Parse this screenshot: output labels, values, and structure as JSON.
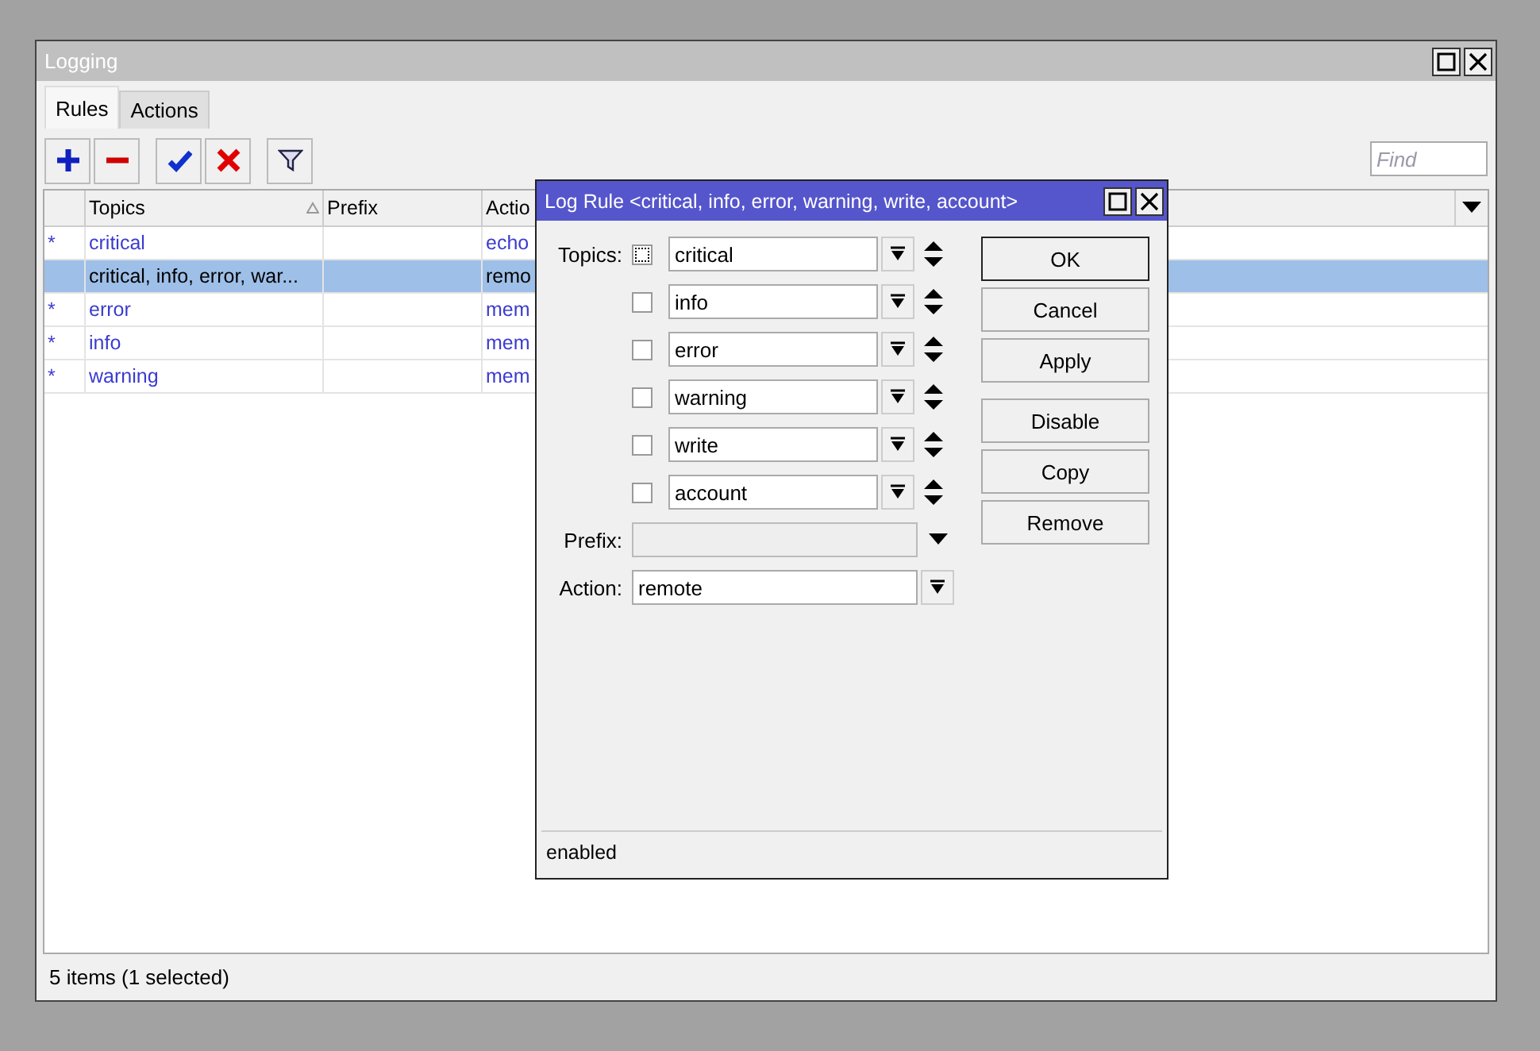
{
  "window": {
    "title": "Logging"
  },
  "tabs": [
    {
      "label": "Rules",
      "selected": true
    },
    {
      "label": "Actions",
      "selected": false
    }
  ],
  "toolbar": {
    "buttons": [
      {
        "kind": "add"
      },
      {
        "kind": "remove"
      },
      {
        "kind": "enable"
      },
      {
        "kind": "disable"
      },
      {
        "kind": "filter"
      }
    ],
    "find": {
      "placeholder": "Find"
    }
  },
  "table": {
    "columns": [
      {
        "label": "Topics",
        "sorted": true
      },
      {
        "label": "Prefix",
        "sorted": false
      },
      {
        "label": "Actio"
      }
    ],
    "rows": [
      {
        "flag": "*",
        "dynamic": true,
        "selected": false,
        "cells": [
          "critical",
          "",
          "echo"
        ]
      },
      {
        "dynamic": false,
        "selected": true,
        "cells": [
          "critical, info, error, war...",
          "",
          "remo"
        ]
      },
      {
        "flag": "*",
        "dynamic": true,
        "selected": false,
        "cells": [
          "error",
          "",
          "mem"
        ]
      },
      {
        "flag": "*",
        "dynamic": true,
        "selected": false,
        "cells": [
          "info",
          "",
          "mem"
        ]
      },
      {
        "flag": "*",
        "dynamic": true,
        "selected": false,
        "cells": [
          "warning",
          "",
          "mem"
        ]
      }
    ]
  },
  "status_bar": "5 items (1 selected)",
  "dialog": {
    "title": "Log Rule <critical, info, error, warning, write, account>",
    "topics_label": "Topics:",
    "topics": [
      {
        "value": "critical",
        "checked": false,
        "focused": true
      },
      {
        "value": "info",
        "checked": false,
        "focused": false
      },
      {
        "value": "error",
        "checked": false,
        "focused": false
      },
      {
        "value": "warning",
        "checked": false,
        "focused": false
      },
      {
        "value": "write",
        "checked": false,
        "focused": false
      },
      {
        "value": "account",
        "checked": false,
        "focused": false
      }
    ],
    "prefix_label": "Prefix:",
    "prefix": {
      "disabled": true
    },
    "action_label": "Action:",
    "action": "remote",
    "buttons": [
      {
        "label": "OK",
        "default": true
      },
      {
        "label": "Cancel",
        "default": false
      },
      {
        "label": "Apply",
        "default": false
      },
      {
        "label": "Disable",
        "default": false
      },
      {
        "label": "Copy",
        "default": false
      },
      {
        "label": "Remove",
        "default": false
      }
    ],
    "status": "enabled"
  }
}
